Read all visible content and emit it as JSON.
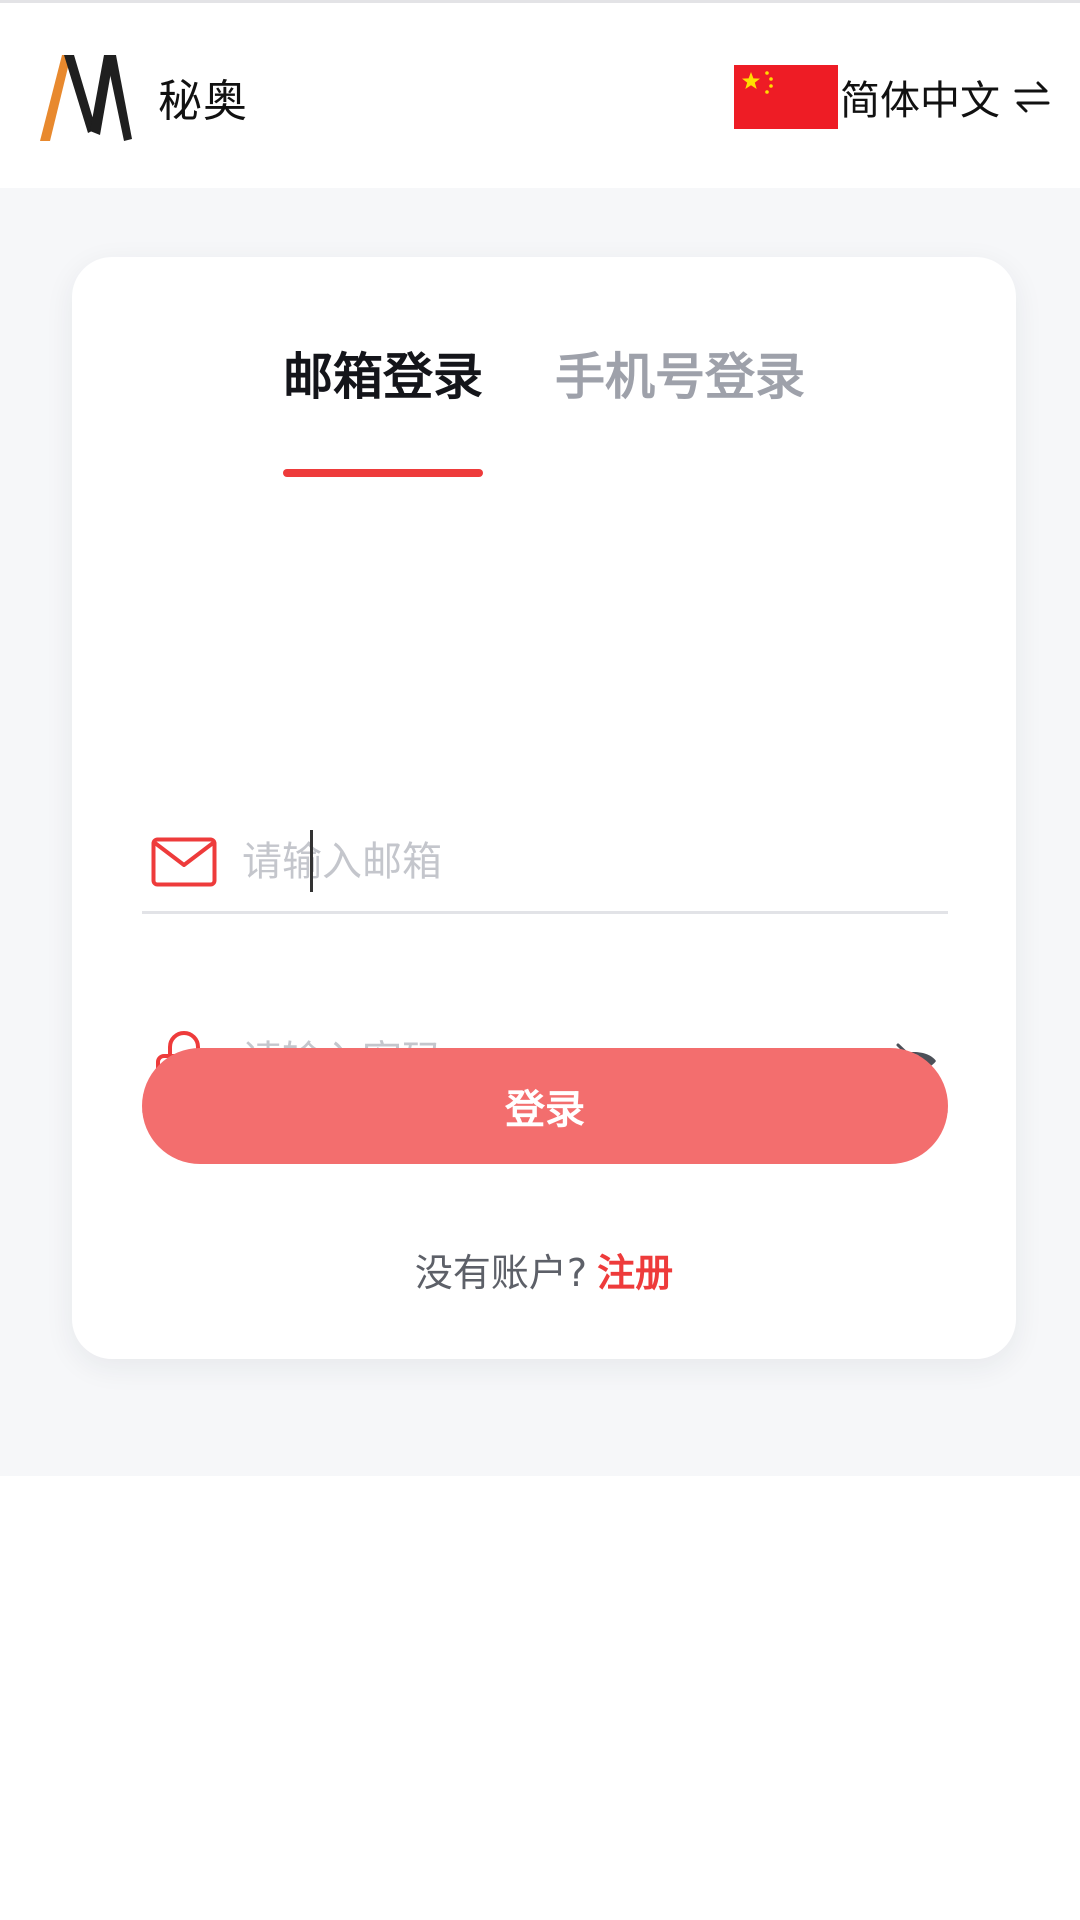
{
  "header": {
    "brand_name": "秘奥",
    "language_label": "简体中文"
  },
  "login": {
    "tabs": [
      {
        "label": "邮箱登录",
        "active": true
      },
      {
        "label": "手机号登录",
        "active": false
      }
    ],
    "email": {
      "value": "",
      "placeholder": "请输入邮箱"
    },
    "password": {
      "value": "",
      "placeholder": "请输入密码"
    },
    "submit_label": "登录",
    "register_prompt": "没有账户?",
    "register_link": "注册"
  },
  "icons": {
    "logo": "brand-m-logo",
    "flag": "china-flag-icon",
    "swap": "swap-arrows-icon",
    "email": "envelope-icon",
    "password": "lock-icon",
    "visibility": "eye-off-icon"
  },
  "colors": {
    "accent": "#ee3b3b",
    "button": "#f36e6e",
    "logo_orange": "#e8892e",
    "flag_red": "#ee1c25",
    "flag_star": "#ffde00"
  }
}
